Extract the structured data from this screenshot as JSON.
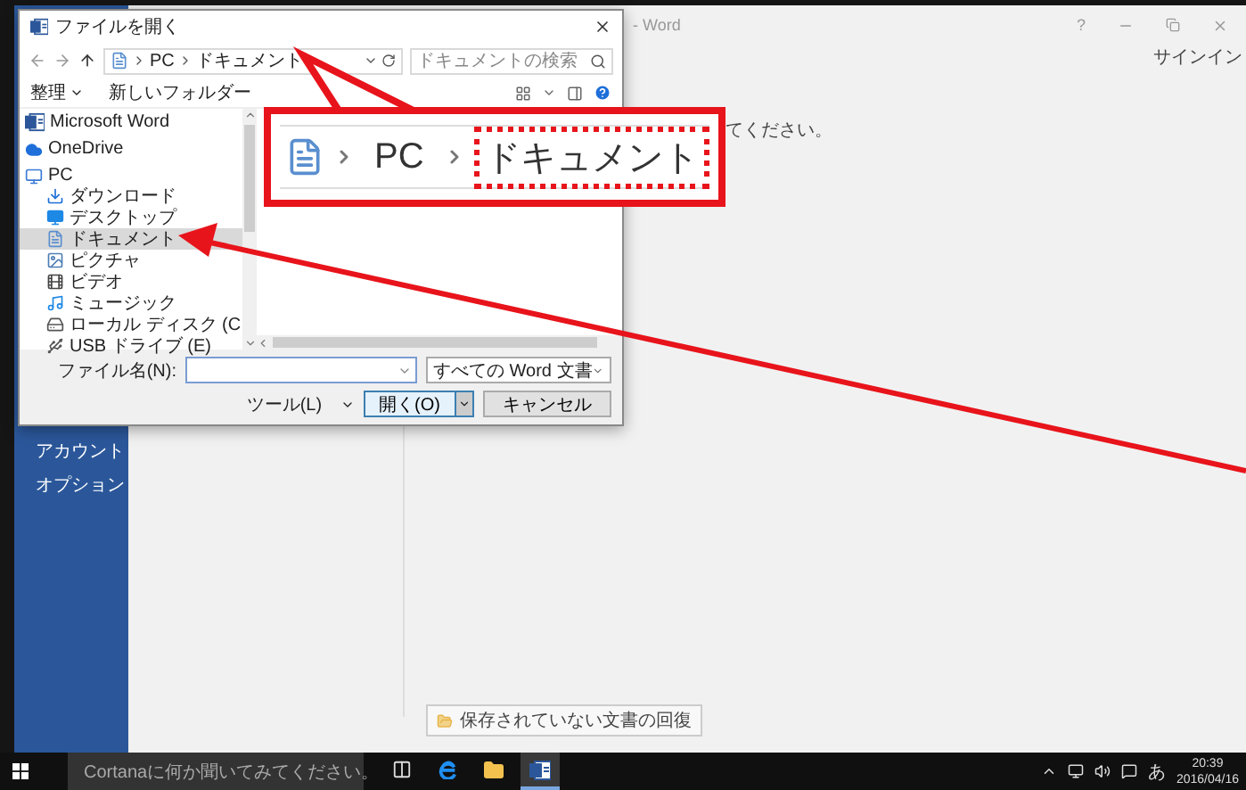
{
  "word": {
    "title": "- Word",
    "help": "?",
    "sign_in": "サインイン",
    "message": "てください。",
    "menu": [
      {
        "label": "アカウント"
      },
      {
        "label": "オプション"
      }
    ],
    "recover_button": "保存されていない文書の回復"
  },
  "dialog": {
    "title": "ファイルを開く",
    "breadcrumb": [
      "PC",
      "ドキュメント"
    ],
    "search": {
      "placeholder": "ドキュメントの検索"
    },
    "organize": "整理",
    "new_folder": "新しいフォルダー",
    "nav_tree": [
      {
        "kind": "word",
        "label": "Microsoft Word",
        "selected": false
      },
      {
        "kind": "cloud",
        "label": "OneDrive",
        "selected": false
      },
      {
        "kind": "pc",
        "label": "PC",
        "selected": false,
        "children": [
          {
            "kind": "download",
            "label": "ダウンロード",
            "selected": false
          },
          {
            "kind": "desktop",
            "label": "デスクトップ",
            "selected": false
          },
          {
            "kind": "documents",
            "label": "ドキュメント",
            "selected": true
          },
          {
            "kind": "pictures",
            "label": "ピクチャ",
            "selected": false
          },
          {
            "kind": "videos",
            "label": "ビデオ",
            "selected": false
          },
          {
            "kind": "music",
            "label": "ミュージック",
            "selected": false
          },
          {
            "kind": "drive",
            "label": "ローカル ディスク (C",
            "selected": false
          },
          {
            "kind": "usb",
            "label": "USB ドライブ (E)",
            "selected": false
          }
        ]
      }
    ],
    "file_name_label": "ファイル名(N):",
    "filter": "すべての Word 文書",
    "tools": "ツール(L)",
    "open": "開く(O)",
    "cancel": "キャンセル"
  },
  "callout": {
    "breadcrumb": [
      {
        "label": "PC",
        "highlighted": false
      },
      {
        "label": "ドキュメント",
        "highlighted": true
      }
    ]
  },
  "taskbar": {
    "search": {
      "placeholder": "Cortanaに何か聞いてみてください。"
    },
    "apps": [
      {
        "kind": "task-view",
        "active": false
      },
      {
        "kind": "edge",
        "active": false
      },
      {
        "kind": "explorer",
        "active": false
      },
      {
        "kind": "word",
        "active": true
      }
    ],
    "ime": "あ",
    "time": "20:39",
    "date": "2016/04/16"
  }
}
